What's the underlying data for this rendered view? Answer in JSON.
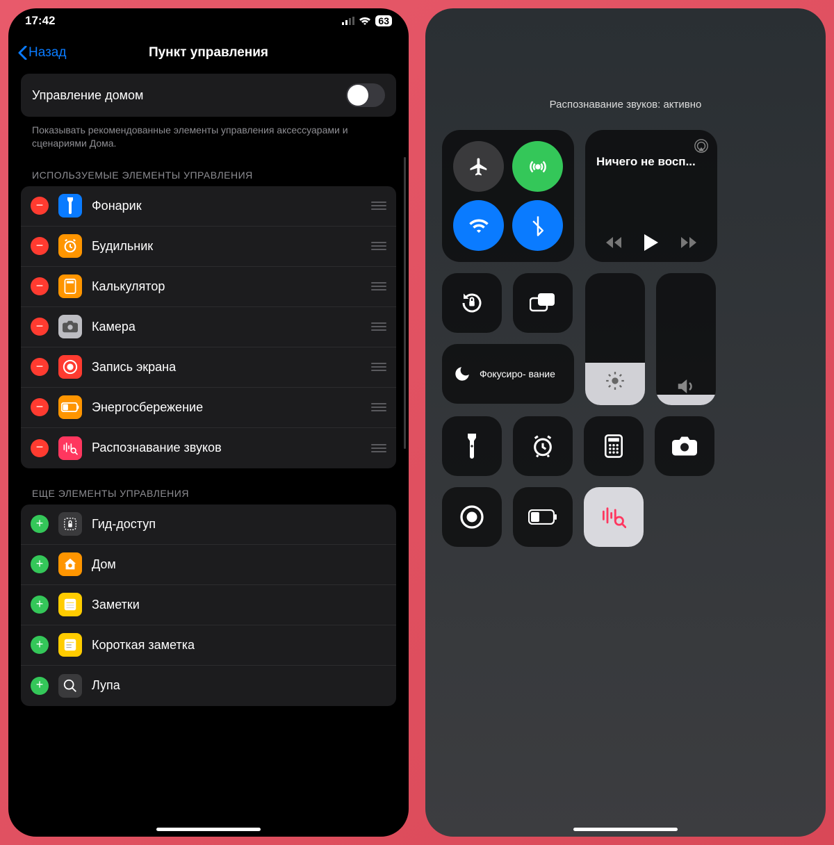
{
  "statusBar": {
    "time": "17:42",
    "battery": "63"
  },
  "nav": {
    "back": "Назад",
    "title": "Пункт управления"
  },
  "toggleCard": {
    "label": "Управление домом",
    "desc": "Показывать рекомендованные элементы управления аксессуарами и сценариями Дома."
  },
  "sections": {
    "usedTitle": "ИСПОЛЬЗУЕМЫЕ ЭЛЕМЕНТЫ УПРАВЛЕНИЯ",
    "usedItems": [
      {
        "label": "Фонарик",
        "iconBg": "#0a7bff"
      },
      {
        "label": "Будильник",
        "iconBg": "#ff9500"
      },
      {
        "label": "Калькулятор",
        "iconBg": "#ff9500"
      },
      {
        "label": "Камера",
        "iconBg": "#bdbdc2"
      },
      {
        "label": "Запись экрана",
        "iconBg": "#ff3b30"
      },
      {
        "label": "Энергосбережение",
        "iconBg": "#ff9500"
      },
      {
        "label": "Распознавание звуков",
        "iconBg": "#ff375f"
      }
    ],
    "moreTitle": "ЕЩЕ ЭЛЕМЕНТЫ УПРАВЛЕНИЯ",
    "moreItems": [
      {
        "label": "Гид-доступ",
        "iconBg": "#3a3a3c"
      },
      {
        "label": "Дом",
        "iconBg": "#ff9500"
      },
      {
        "label": "Заметки",
        "iconBg": "#ffcc00"
      },
      {
        "label": "Короткая заметка",
        "iconBg": "#ffcc00"
      },
      {
        "label": "Лупа",
        "iconBg": "#3a3a3c"
      }
    ]
  },
  "cc": {
    "banner": "Распознавание звуков: активно",
    "mediaTitle": "Ничего не восп...",
    "focusLabel": "Фокусиро- вание",
    "brightnessPct": 32,
    "volumePct": 8
  }
}
